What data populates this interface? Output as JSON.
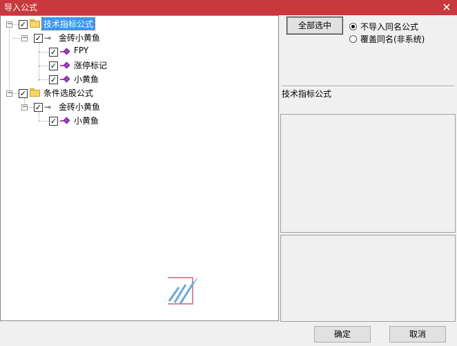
{
  "window": {
    "title": "导入公式",
    "close_glyph": "✕"
  },
  "tree": {
    "nodes": [
      {
        "label": "技术指标公式",
        "checked": true,
        "selected": true,
        "icon": "folder-icon"
      },
      {
        "label": "金砖小黄鱼",
        "checked": true,
        "icon": "key-icon"
      },
      {
        "label": "FPY",
        "checked": true,
        "icon": "formula-icon"
      },
      {
        "label": "涨停标记",
        "checked": true,
        "icon": "formula-icon"
      },
      {
        "label": "小黄鱼",
        "checked": true,
        "icon": "formula-icon"
      },
      {
        "label": "条件选股公式",
        "checked": true,
        "icon": "folder-icon"
      },
      {
        "label": "金砖小黄鱼",
        "checked": true,
        "icon": "key-icon"
      },
      {
        "label": "小黄鱼",
        "checked": true,
        "icon": "formula-icon"
      }
    ]
  },
  "right": {
    "select_all_label": "全部选中",
    "radio_options": [
      {
        "label": "不导入同名公式",
        "checked": true
      },
      {
        "label": "覆盖同名(非系统)",
        "checked": false
      }
    ],
    "category_label": "技术指标公式"
  },
  "footer": {
    "ok_label": "确定",
    "cancel_label": "取消"
  },
  "colors": {
    "title_bar": "#c8383c",
    "selection": "#3399ff"
  }
}
